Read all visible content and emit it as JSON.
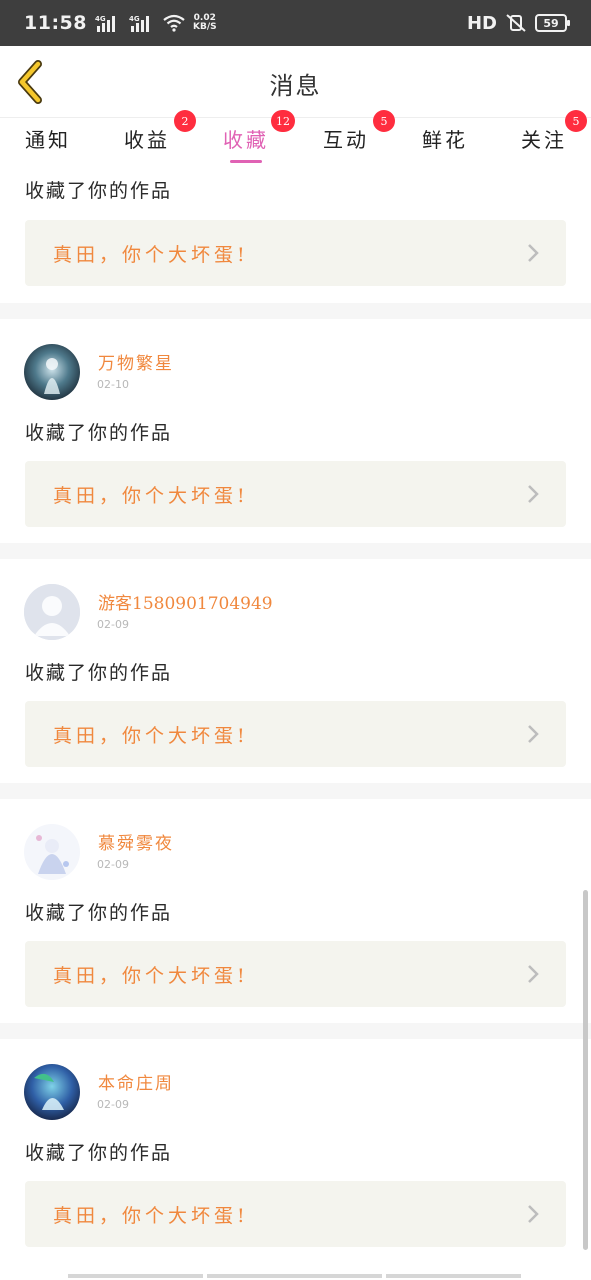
{
  "status_bar": {
    "time": "11:58",
    "net_speed_value": "0.02",
    "net_speed_unit": "KB/S",
    "hd_label": "HD",
    "battery": "59"
  },
  "header": {
    "title": "消息"
  },
  "tabs": [
    {
      "label": "通知",
      "badge": ""
    },
    {
      "label": "收益",
      "badge": "2"
    },
    {
      "label": "收藏",
      "badge": "12"
    },
    {
      "label": "互动",
      "badge": "5"
    },
    {
      "label": "鲜花",
      "badge": ""
    },
    {
      "label": "关注",
      "badge": "5"
    }
  ],
  "active_tab": "收藏",
  "colors": {
    "accent": "#e062b4",
    "username": "#f0883e",
    "badge": "#ff2d3f",
    "back_icon": "#f5c72c"
  },
  "partial_item": {
    "action": "收藏了你的作品",
    "work_title": "真田，你个大坏蛋!"
  },
  "items": [
    {
      "username": "万物繁星",
      "date": "02-10",
      "action": "收藏了你的作品",
      "work_title": "真田，你个大坏蛋!",
      "avatar": "anime-avatar-dark"
    },
    {
      "username": "游客1580901704949",
      "date": "02-09",
      "action": "收藏了你的作品",
      "work_title": "真田，你个大坏蛋!",
      "avatar": "default-user-avatar"
    },
    {
      "username": "慕舜雾夜",
      "date": "02-09",
      "action": "收藏了你的作品",
      "work_title": "真田，你个大坏蛋!",
      "avatar": "anime-avatar-light"
    },
    {
      "username": "本命庄周",
      "date": "02-09",
      "action": "收藏了你的作品",
      "work_title": "真田，你个大坏蛋!",
      "avatar": "anime-avatar-blue"
    }
  ]
}
